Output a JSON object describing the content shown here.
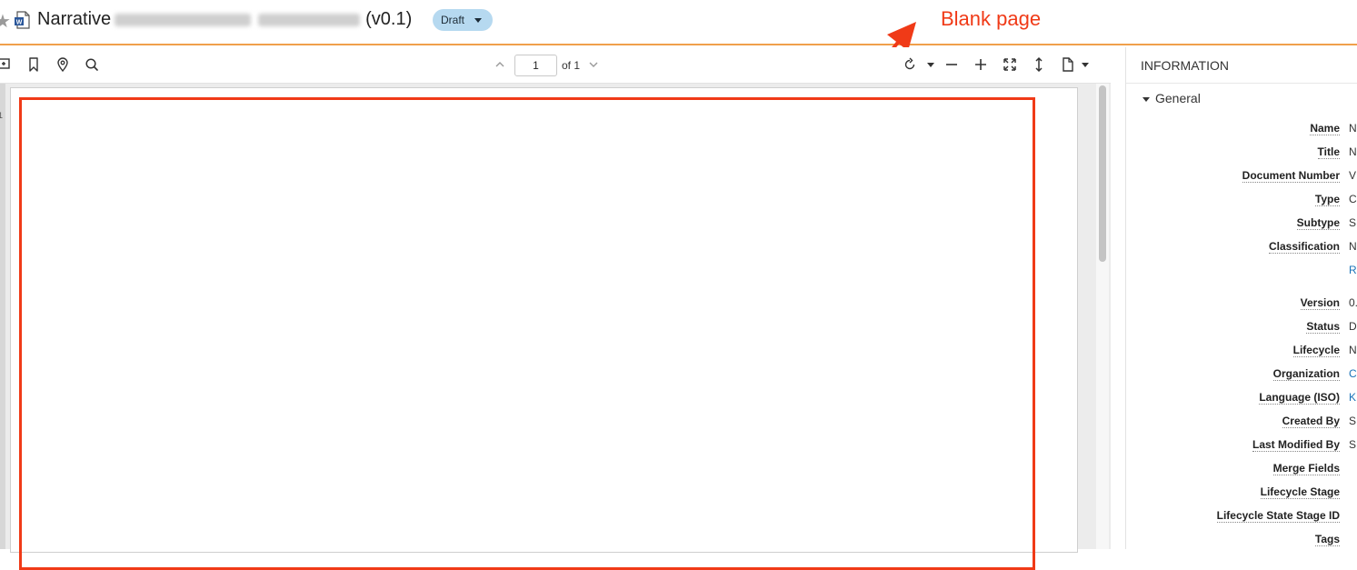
{
  "header": {
    "title_prefix": "Narrative",
    "title_version": "(v0.1)",
    "status_label": "Draft",
    "annotation": "Blank page"
  },
  "toolbar": {
    "page_value": "1",
    "page_total": "of 1"
  },
  "thumbnails": {
    "first_number": "1"
  },
  "info": {
    "header": "INFORMATION",
    "section": "General",
    "fields": [
      {
        "label": "Name",
        "value": "N"
      },
      {
        "label": "Title",
        "value": "N"
      },
      {
        "label": "Document Number",
        "value": "V"
      },
      {
        "label": "Type",
        "value": "C"
      },
      {
        "label": "Subtype",
        "value": "S"
      },
      {
        "label": "Classification",
        "value": "N",
        "extra": "R"
      },
      {
        "label": "Version",
        "value": "0."
      },
      {
        "label": "Status",
        "value": "D"
      },
      {
        "label": "Lifecycle",
        "value": "N"
      },
      {
        "label": "Organization",
        "value": "C"
      },
      {
        "label": "Language (ISO)",
        "value": "K"
      },
      {
        "label": "Created By",
        "value": "S"
      },
      {
        "label": "Last Modified By",
        "value": "S"
      },
      {
        "label": "Merge Fields",
        "value": ""
      },
      {
        "label": "Lifecycle Stage",
        "value": ""
      },
      {
        "label": "Lifecycle State Stage ID",
        "value": ""
      },
      {
        "label": "Tags",
        "value": ""
      }
    ]
  },
  "colors": {
    "accent_orange": "#f0a04b",
    "annotation_red": "#f03a17",
    "status_pill": "#b6d9f0",
    "link_blue": "#1a73b8"
  }
}
